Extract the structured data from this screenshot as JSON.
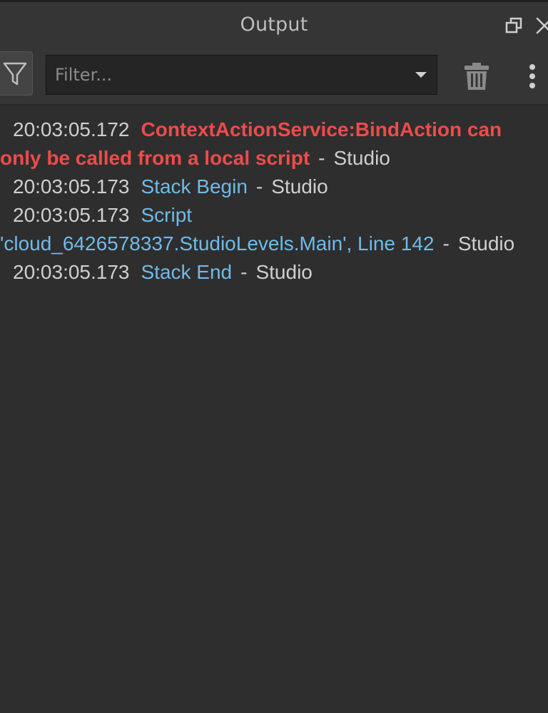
{
  "panel": {
    "title": "Output"
  },
  "window_controls": {
    "restore_icon": "restore-window-icon",
    "close_icon": "close-icon"
  },
  "toolbar": {
    "filter_icon": "filter-funnel-icon",
    "filter_placeholder": "Filter...",
    "filter_value": "",
    "dropdown_icon": "chevron-down-icon",
    "clear_icon": "trash-icon",
    "more_icon": "more-vertical-icon"
  },
  "colors": {
    "error": "#ef4b4b",
    "info": "#6fbbe8",
    "text": "#cccccc",
    "background": "#2e2e2e"
  },
  "log_entries": [
    {
      "timestamp": "20:03:05.172",
      "message": "ContextActionService:BindAction can only be called from a local script",
      "separator": "-",
      "source": "Studio",
      "level": "error"
    },
    {
      "timestamp": "20:03:05.173",
      "message": "Stack Begin",
      "separator": "-",
      "source": "Studio",
      "level": "info"
    },
    {
      "timestamp": "20:03:05.173",
      "message": "Script 'cloud_6426578337.StudioLevels.Main', Line 142",
      "separator": "-",
      "source": "Studio",
      "level": "info"
    },
    {
      "timestamp": "20:03:05.173",
      "message": "Stack End",
      "separator": "-",
      "source": "Studio",
      "level": "info"
    }
  ]
}
